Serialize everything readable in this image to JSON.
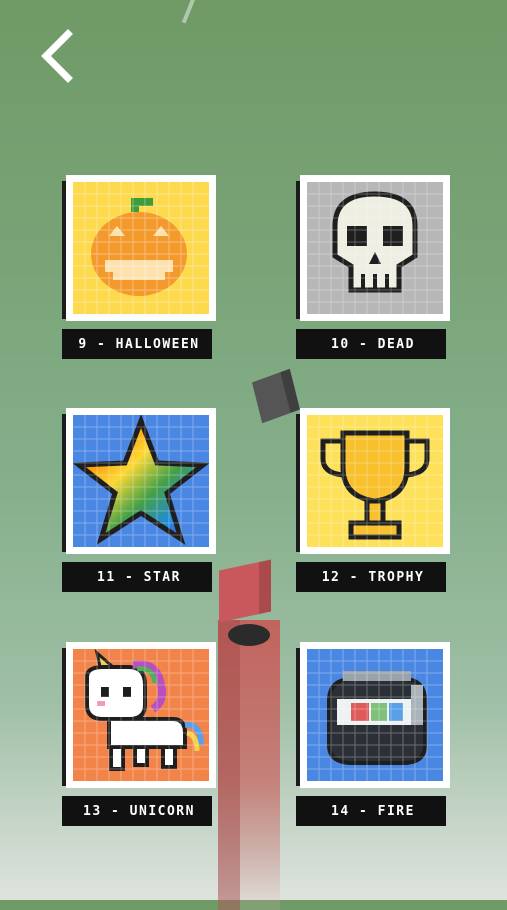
{
  "header": {
    "back_icon": "chevron-left-icon"
  },
  "levels": [
    {
      "label": "9 - HALLOWEEN",
      "bg": "#fdd94e",
      "icon": "pumpkin-icon"
    },
    {
      "label": "10 - DEAD",
      "bg": "#b7b7b7",
      "icon": "skull-icon"
    },
    {
      "label": "11 - STAR",
      "bg": "#4a87e3",
      "icon": "rainbow-star-icon"
    },
    {
      "label": "12 - TROPHY",
      "bg": "#fde15a",
      "icon": "trophy-icon"
    },
    {
      "label": "13 - UNICORN",
      "bg": "#f2844a",
      "icon": "unicorn-icon"
    },
    {
      "label": "14 - FIRE",
      "bg": "#4a87e3",
      "icon": "fire-icon"
    }
  ]
}
